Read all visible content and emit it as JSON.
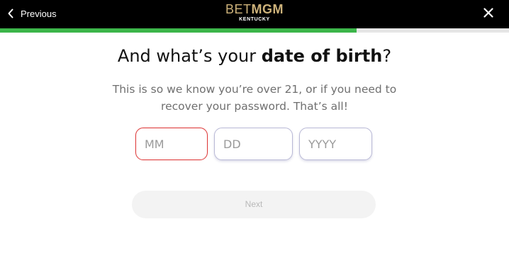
{
  "header": {
    "previous_label": "Previous",
    "logo": {
      "bet": "BET",
      "mgm": "MGM",
      "region": "KENTUCKY"
    },
    "icons": {
      "previous": "chevron-left-icon",
      "close": "close-icon"
    }
  },
  "progress": {
    "fraction": 0.7,
    "fill_color": "#3cb64a",
    "track_color": "#e6e6e6"
  },
  "main": {
    "heading_prefix": "And what’s your ",
    "heading_bold": "date of birth",
    "heading_suffix": "?",
    "subtext": "This is so we know you’re over 21, or if you need to recover your password. That’s all!",
    "fields": {
      "month_placeholder": "MM",
      "day_placeholder": "DD",
      "year_placeholder": "YYYY"
    },
    "next_label": "Next"
  },
  "colors": {
    "topbar": "#000000",
    "brand_gold": "#cdb27a",
    "error_border": "#de3a3a",
    "field_border": "#b9b9d6"
  }
}
